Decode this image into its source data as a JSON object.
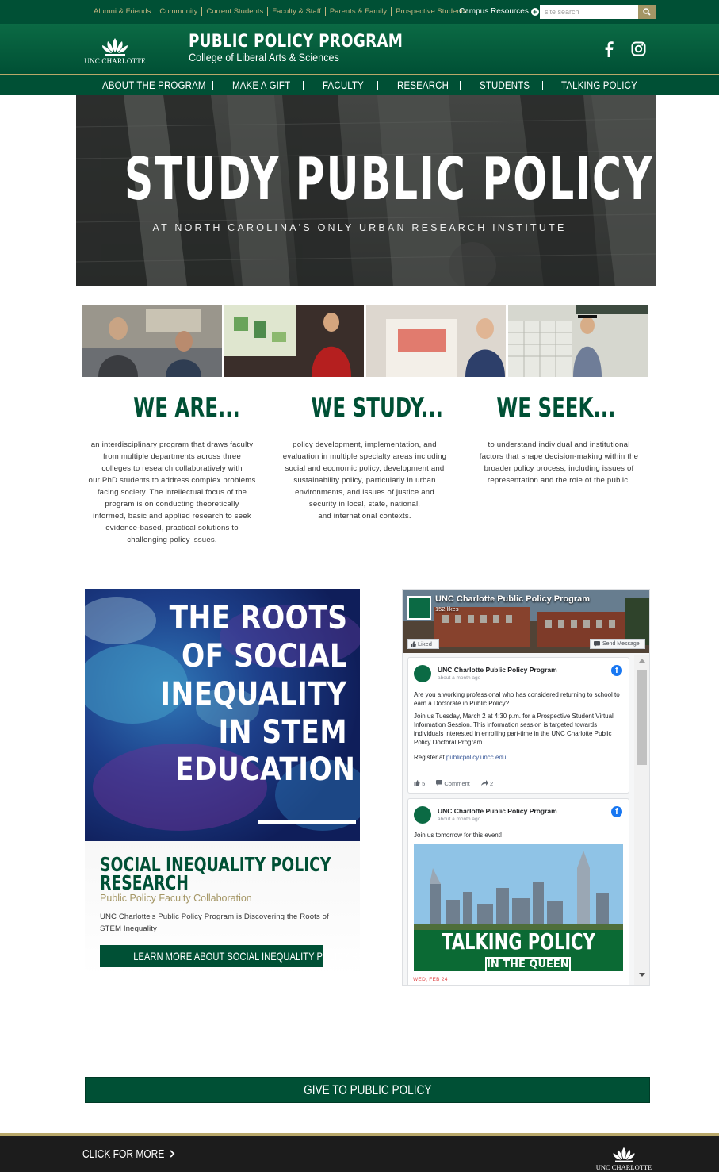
{
  "utility": {
    "links": [
      "Alumni & Friends",
      "Community",
      "Current Students",
      "Faculty & Staff",
      "Parents & Family",
      "Prospective Students"
    ],
    "campus_resources": "Campus Resources",
    "search_placeholder": "site search"
  },
  "header": {
    "logo_text": "UNC CHARLOTTE",
    "title": "PUBLIC POLICY PROGRAM",
    "subtitle": "College of Liberal Arts & Sciences",
    "social_icons": [
      "facebook-icon",
      "instagram-icon"
    ]
  },
  "nav": {
    "items": [
      "ABOUT THE PROGRAM",
      "MAKE A GIFT",
      "FACULTY",
      "RESEARCH",
      "STUDENTS",
      "TALKING POLICY"
    ]
  },
  "hero": {
    "headline": "STUDY PUBLIC POLICY",
    "subheadline": "AT NORTH CAROLINA'S ONLY URBAN RESEARCH INSTITUTE"
  },
  "columns": [
    {
      "heading": "WE ARE...",
      "lines": [
        "an interdisciplinary program that draws faculty",
        "from multiple departments across three",
        "colleges to research collaboratively with",
        "our PhD students to address complex problems",
        "facing society. The intellectual focus of the",
        "program is on conducting theoretically",
        "informed, basic and applied research to seek",
        "evidence-based, practical solutions to",
        "challenging policy issues."
      ]
    },
    {
      "heading": "WE STUDY...",
      "lines": [
        "policy development, implementation, and",
        "evaluation in multiple specialty areas including",
        "social and economic policy, development and",
        "sustainability policy, particularly in urban",
        "environments, and issues of justice and",
        "security in local, state, national,",
        "and international contexts."
      ]
    },
    {
      "heading": "WE SEEK...",
      "lines": [
        "to understand individual and institutional",
        "factors that shape decision-making within the",
        "broader policy process, including issues of",
        "representation and the role of the public."
      ]
    }
  ],
  "feature": {
    "image_title_lines": [
      "THE ROOTS",
      "OF SOCIAL",
      "INEQUALITY",
      "IN STEM",
      "EDUCATION"
    ],
    "heading_lines": [
      "SOCIAL INEQUALITY POLICY",
      "RESEARCH"
    ],
    "subheading": "Public Policy Faculty Collaboration",
    "description": "UNC Charlotte's Public Policy Program is Discovering the Roots of STEM Inequality",
    "button": "LEARN MORE ABOUT SOCIAL INEQUALITY POLICY RESEARCH"
  },
  "facebook": {
    "page_name": "UNC Charlotte Public Policy Program",
    "likes": "152 likes",
    "liked_label": "Liked",
    "send_message_label": "Send Message",
    "posts": [
      {
        "author": "UNC Charlotte Public Policy Program",
        "time": "about a month ago",
        "paragraphs": [
          "Are you a working professional who has considered returning to school to earn a Doctorate in Public Policy?",
          "Join us Tuesday, March 2 at 4:30 p.m. for a Prospective Student Virtual Information Session. This information session is targeted towards individuals interested in enrolling part-time in the UNC Charlotte Public Policy Doctoral Program."
        ],
        "register_prefix": "Register at ",
        "register_link": "publicpolicy.uncc.edu",
        "likes": "5",
        "comment_label": "Comment",
        "shares": "2"
      },
      {
        "author": "UNC Charlotte Public Policy Program",
        "time": "about a month ago",
        "text": "Join us tomorrow for this event!",
        "image_title": "TALKING POLICY",
        "image_subtitle": "IN THE QUEEN CITY",
        "event_date": "WED, FEB 24"
      }
    ]
  },
  "give": {
    "label": "GIVE TO PUBLIC POLICY"
  },
  "footer": {
    "more_label": "CLICK FOR MORE",
    "logo_text": "UNC CHARLOTTE"
  },
  "colors": {
    "brand_green": "#005035",
    "gold": "#b9a86a",
    "gold_text": "#a49665",
    "footer_dark": "#1c1c1c"
  }
}
